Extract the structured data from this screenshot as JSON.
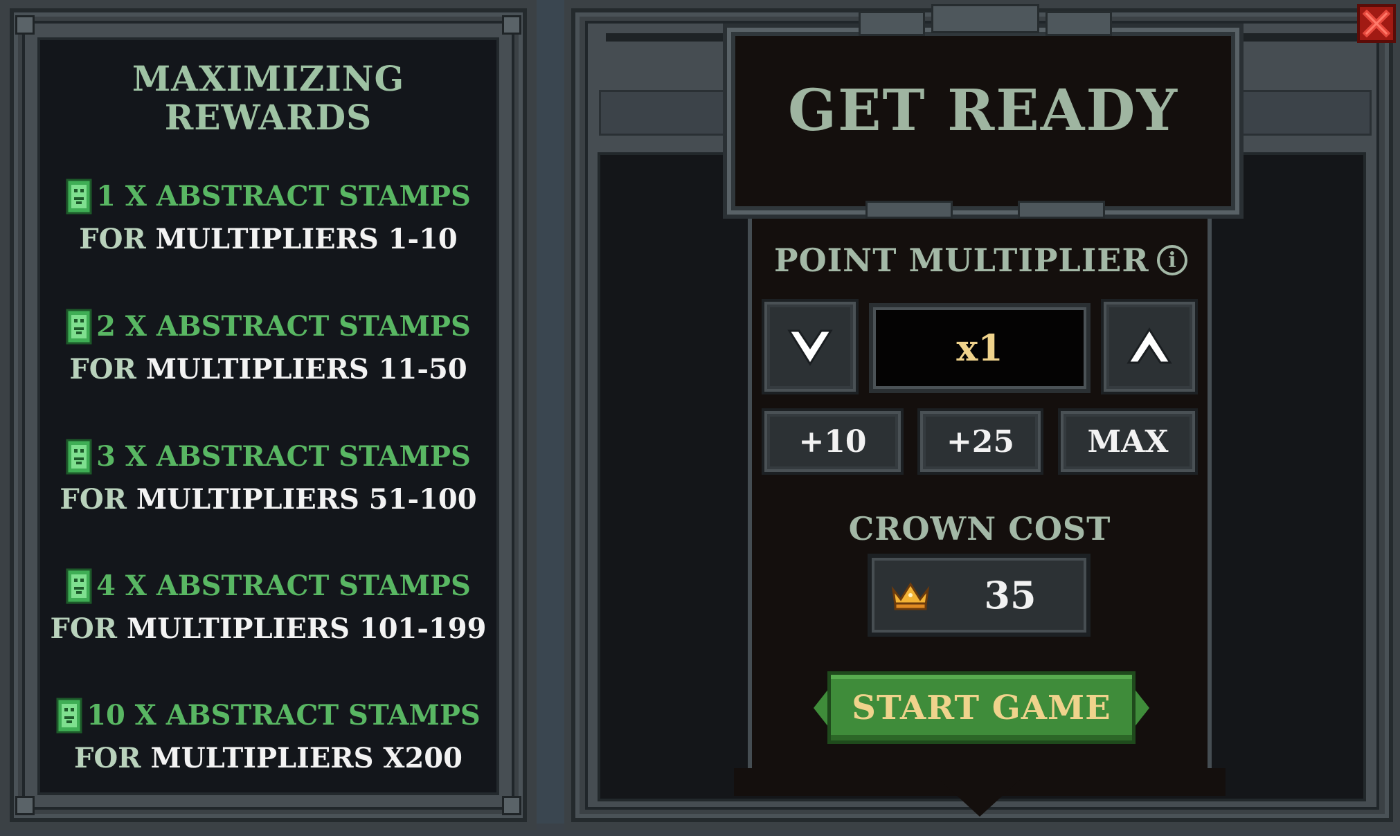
{
  "left_panel": {
    "title_line1": "MAXIMIZING",
    "title_line2": "REWARDS",
    "rewards": [
      {
        "stamps": "1 X ABSTRACT STAMPS",
        "for": "FOR",
        "multipliers": "MULTIPLIERS 1-10"
      },
      {
        "stamps": "2 X ABSTRACT STAMPS",
        "for": "FOR",
        "multipliers": "MULTIPLIERS 11-50"
      },
      {
        "stamps": "3 X ABSTRACT STAMPS",
        "for": "FOR",
        "multipliers": "MULTIPLIERS 51-100"
      },
      {
        "stamps": "4 X ABSTRACT STAMPS",
        "for": "FOR",
        "multipliers": "MULTIPLIERS 101-199"
      },
      {
        "stamps": "10 X ABSTRACT STAMPS",
        "for": "FOR",
        "multipliers": "MULTIPLIERS X200"
      }
    ],
    "stamp_icon": "abstract-stamp-icon",
    "colors": {
      "title": "#9fc3a4",
      "stamps": "#59b763",
      "for": "#b9d2bc",
      "multipliers": "#f3f3f3"
    }
  },
  "right_panel": {
    "title": "GET READY",
    "point_multiplier_label": "POINT MULTIPLIER",
    "info_glyph": "i",
    "multiplier_value": "x1",
    "decrease_icon": "chevron-down-icon",
    "increase_icon": "chevron-up-icon",
    "quick_buttons": [
      "+10",
      "+25",
      "MAX"
    ],
    "crown_cost_label": "CROWN COST",
    "crown_cost_value": "35",
    "crown_icon": "crown-icon",
    "start_button": "START GAME",
    "close_icon": "close-icon",
    "colors": {
      "title": "#9fb5a1",
      "multiplier_value": "#f0d38c",
      "start_button_bg": "#3f8c3a",
      "start_button_text": "#f0d38c",
      "close_bg": "#a11a13"
    }
  }
}
